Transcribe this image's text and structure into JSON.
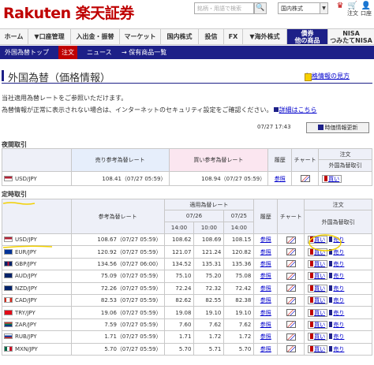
{
  "header": {
    "logo": "Rakuten 楽天証券",
    "search_placeholder": "銘柄・用語で検索",
    "search_icon_glyph": "🔍",
    "market": "国内株式",
    "market_arrow": "▼",
    "icons": [
      {
        "name": "ranking-icon",
        "label": ""
      },
      {
        "name": "order-icon",
        "label": "注文"
      },
      {
        "name": "account-icon",
        "label": "口座"
      }
    ]
  },
  "nav": [
    {
      "label": "ホーム"
    },
    {
      "label": "▼口座管理"
    },
    {
      "label": "入出金・振替"
    },
    {
      "label": "マーケット"
    },
    {
      "label": "国内株式"
    },
    {
      "label": "投信"
    },
    {
      "label": "FX"
    },
    {
      "label": "▼海外株式"
    },
    {
      "label": "債券・他の商品",
      "line1": "債券",
      "line2": "他の商品"
    },
    {
      "label": "NISA つみたてNISA",
      "line1": "NISA",
      "line2": "つみたてNISA"
    }
  ],
  "subnav": [
    "外国為替トップ",
    "注文",
    "ニュース",
    "→ 保有商品一覧"
  ],
  "page": {
    "title": "外国為替（価格情報）",
    "price_info_link": "価格情報の見方",
    "desc1": "当社適用為替レートをご参照いただけます。",
    "desc2a": "為替情報が正常に表示されない場合は、インターネットのセキュリティ設定をご確認ください。",
    "desc2_link": "詳細はこちら",
    "timestamp": "07/27 17:43",
    "refresh_label": "時価情報更新"
  },
  "night": {
    "section": "夜間取引",
    "headers": {
      "sell": "売り参考為替レート",
      "buy": "買い参考為替レート",
      "history": "履歴",
      "chart": "チャート",
      "order_top": "注文",
      "order_sub": "外国為替取引"
    },
    "row": {
      "pair": "USD/JPY",
      "sell": "108.41（07/27 05:59）",
      "buy": "108.94（07/27 05:59）",
      "history": "参照",
      "buy_label": "買い"
    }
  },
  "regular": {
    "section": "定時取引",
    "headers": {
      "ref": "参考為替レート",
      "applied": "適用為替レート",
      "d1": "07/26",
      "d2": "07/25",
      "t1": "14:00",
      "t2": "10:00",
      "t3": "14:00",
      "history": "履歴",
      "chart": "チャート",
      "order_top": "注文",
      "order_sub": "外国為替取引"
    },
    "rows": [
      {
        "pair": "USD/JPY",
        "ref": "108.67（07/27 05:59）",
        "a": "108.62",
        "b": "108.69",
        "c": "108.15",
        "flag": "us"
      },
      {
        "pair": "EUR/JPY",
        "ref": "120.92（07/27 05:59）",
        "a": "121.07",
        "b": "121.24",
        "c": "120.82",
        "flag": "eu"
      },
      {
        "pair": "GBP/JPY",
        "ref": "134.56（07/27 06:00）",
        "a": "134.52",
        "b": "135.31",
        "c": "135.36",
        "flag": "gb"
      },
      {
        "pair": "AUD/JPY",
        "ref": "75.09（07/27 05:59）",
        "a": "75.10",
        "b": "75.20",
        "c": "75.08",
        "flag": "au"
      },
      {
        "pair": "NZD/JPY",
        "ref": "72.26（07/27 05:59）",
        "a": "72.24",
        "b": "72.32",
        "c": "72.42",
        "flag": "nz"
      },
      {
        "pair": "CAD/JPY",
        "ref": "82.53（07/27 05:59）",
        "a": "82.62",
        "b": "82.55",
        "c": "82.38",
        "flag": "ca"
      },
      {
        "pair": "TRY/JPY",
        "ref": "19.06（07/27 05:59）",
        "a": "19.08",
        "b": "19.10",
        "c": "19.10",
        "flag": "tr"
      },
      {
        "pair": "ZAR/JPY",
        "ref": "7.59（07/27 05:59）",
        "a": "7.60",
        "b": "7.62",
        "c": "7.62",
        "flag": "za"
      },
      {
        "pair": "RUB/JPY",
        "ref": "1.71（07/27 05:59）",
        "a": "1.71",
        "b": "1.72",
        "c": "1.72",
        "flag": "ru"
      },
      {
        "pair": "MXN/JPY",
        "ref": "5.70（07/27 05:59）",
        "a": "5.70",
        "b": "5.71",
        "c": "5.70",
        "flag": "mx"
      }
    ],
    "history_label": "参照",
    "buy_label": "買い",
    "sell_label": "売り"
  },
  "colors": {
    "brand_red": "#bf0000",
    "navy": "#1d2088",
    "annotation": "#f2d000"
  }
}
